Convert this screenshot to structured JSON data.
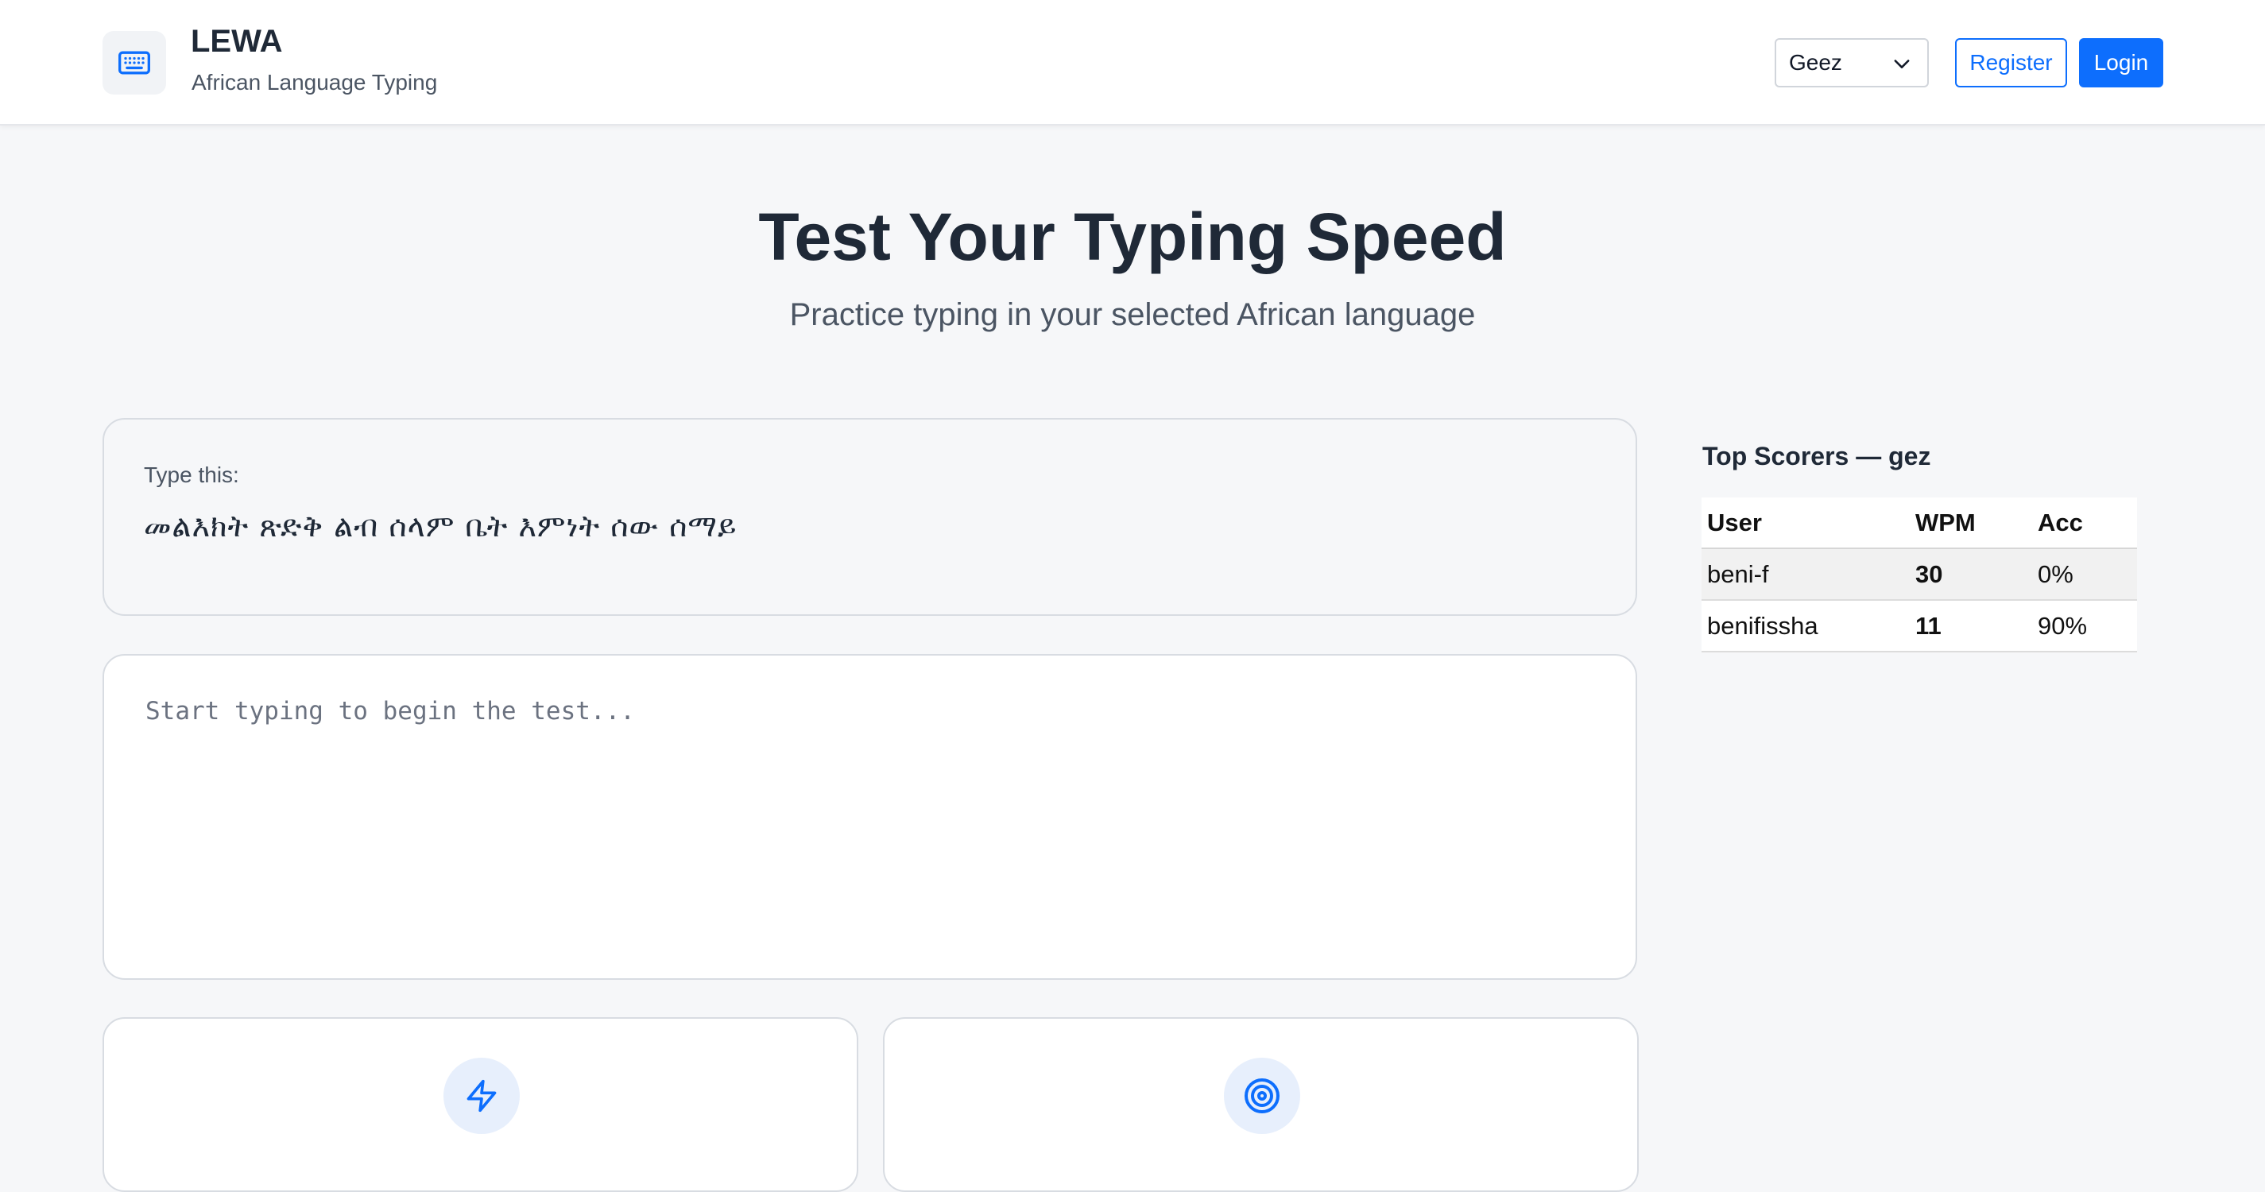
{
  "header": {
    "brand_title": "LEWA",
    "brand_subtitle": "African Language Typing",
    "logo_icon": "keyboard-icon",
    "language_selected": "Geez",
    "register_label": "Register",
    "login_label": "Login",
    "accent_color": "#0d6efd"
  },
  "hero": {
    "title": "Test Your Typing Speed",
    "subtitle": "Practice typing in your selected African language"
  },
  "prompt": {
    "label": "Type this:",
    "text": "መልእክት ጽድቅ ልብ ሰላም ቤት እምነት ሰው ሰማይ"
  },
  "typing": {
    "placeholder": "Start typing to begin the test...",
    "value": ""
  },
  "stats": {
    "cards": [
      {
        "icon": "lightning-bolt-icon"
      },
      {
        "icon": "target-icon"
      }
    ]
  },
  "leaderboard": {
    "title": "Top Scorers — gez",
    "columns": [
      "User",
      "WPM",
      "Acc"
    ],
    "rows": [
      {
        "user": "beni-f",
        "wpm": "30",
        "acc": "0%"
      },
      {
        "user": "benifissha",
        "wpm": "11",
        "acc": "90%"
      }
    ]
  }
}
